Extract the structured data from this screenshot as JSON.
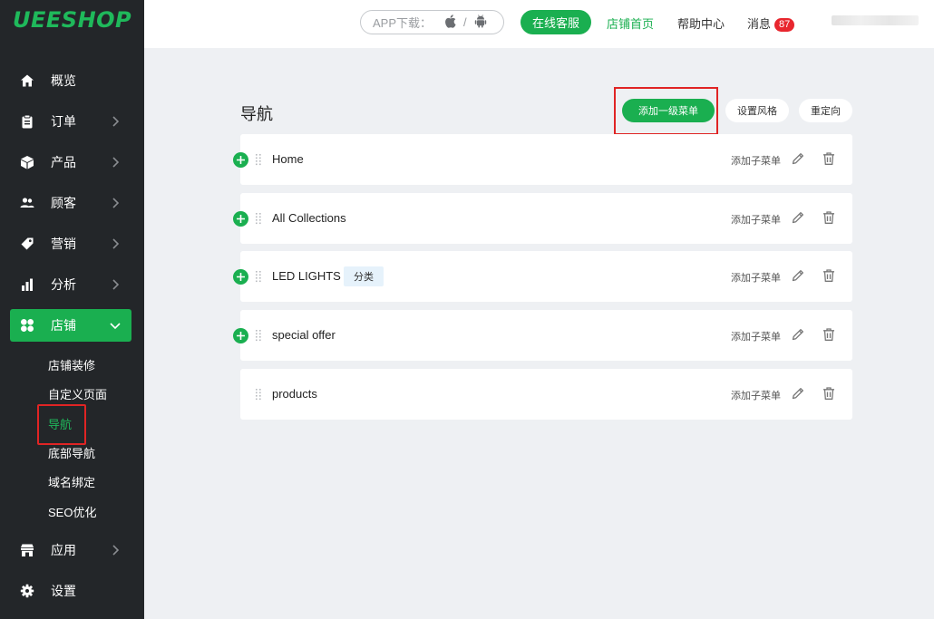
{
  "brand": {
    "logo": "UEESHOP"
  },
  "sidebar": {
    "items": [
      {
        "label": "概览",
        "icon": "home-icon",
        "has_chevron": false
      },
      {
        "label": "订单",
        "icon": "clipboard-icon",
        "has_chevron": true
      },
      {
        "label": "产品",
        "icon": "box-icon",
        "has_chevron": true
      },
      {
        "label": "顾客",
        "icon": "users-icon",
        "has_chevron": true
      },
      {
        "label": "营销",
        "icon": "tag-icon",
        "has_chevron": true
      },
      {
        "label": "分析",
        "icon": "bar-chart-icon",
        "has_chevron": true
      },
      {
        "label": "店铺",
        "icon": "grid-icon",
        "has_chevron": true,
        "active": true
      },
      {
        "label": "应用",
        "icon": "store-icon",
        "has_chevron": true
      },
      {
        "label": "设置",
        "icon": "gear-icon",
        "has_chevron": false
      }
    ],
    "sub_items": [
      {
        "label": "店铺装修"
      },
      {
        "label": "自定义页面"
      },
      {
        "label": "导航",
        "active": true
      },
      {
        "label": "底部导航"
      },
      {
        "label": "域名绑定"
      },
      {
        "label": "SEO优化"
      }
    ]
  },
  "topbar": {
    "app_download": "APP下载：",
    "app_sep": "/",
    "online_service": "在线客服",
    "store_home": "店铺首页",
    "help_center": "帮助中心",
    "messages": "消息",
    "messages_count": "87"
  },
  "main": {
    "title": "导航",
    "add_top_menu": "添加一级菜单",
    "set_style": "设置风格",
    "redirect": "重定向",
    "add_submenu_label": "添加子菜单",
    "rows": [
      {
        "label": "Home",
        "has_plus": true,
        "tag": ""
      },
      {
        "label": "All Collections",
        "has_plus": true,
        "tag": ""
      },
      {
        "label": "LED LIGHTS",
        "has_plus": true,
        "tag": "分类"
      },
      {
        "label": "special offer",
        "has_plus": true,
        "tag": ""
      },
      {
        "label": "products",
        "has_plus": false,
        "tag": ""
      }
    ]
  },
  "colors": {
    "accent": "#1aaf50",
    "sidebar_bg": "#232629",
    "highlight": "#e02424",
    "badge": "#e8262e"
  }
}
